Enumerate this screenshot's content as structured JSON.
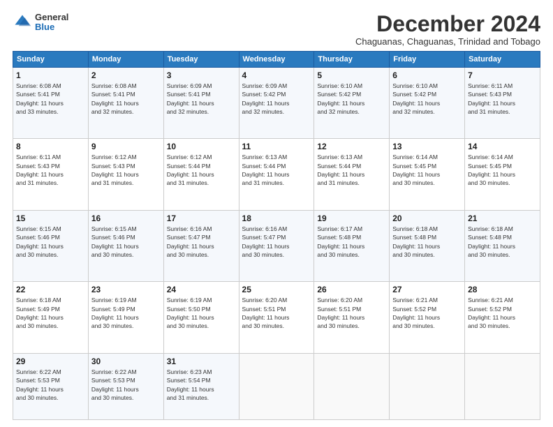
{
  "header": {
    "logo": {
      "general": "General",
      "blue": "Blue"
    },
    "title": "December 2024",
    "subtitle": "Chaguanas, Chaguanas, Trinidad and Tobago"
  },
  "calendar": {
    "days_of_week": [
      "Sunday",
      "Monday",
      "Tuesday",
      "Wednesday",
      "Thursday",
      "Friday",
      "Saturday"
    ],
    "weeks": [
      [
        {
          "day": "",
          "info": ""
        },
        {
          "day": "2",
          "info": "Sunrise: 6:08 AM\nSunset: 5:41 PM\nDaylight: 11 hours\nand 32 minutes."
        },
        {
          "day": "3",
          "info": "Sunrise: 6:09 AM\nSunset: 5:41 PM\nDaylight: 11 hours\nand 32 minutes."
        },
        {
          "day": "4",
          "info": "Sunrise: 6:09 AM\nSunset: 5:42 PM\nDaylight: 11 hours\nand 32 minutes."
        },
        {
          "day": "5",
          "info": "Sunrise: 6:10 AM\nSunset: 5:42 PM\nDaylight: 11 hours\nand 32 minutes."
        },
        {
          "day": "6",
          "info": "Sunrise: 6:10 AM\nSunset: 5:42 PM\nDaylight: 11 hours\nand 32 minutes."
        },
        {
          "day": "7",
          "info": "Sunrise: 6:11 AM\nSunset: 5:43 PM\nDaylight: 11 hours\nand 31 minutes."
        }
      ],
      [
        {
          "day": "1",
          "info": "Sunrise: 6:08 AM\nSunset: 5:41 PM\nDaylight: 11 hours\nand 33 minutes."
        },
        {
          "day": "9",
          "info": "Sunrise: 6:12 AM\nSunset: 5:43 PM\nDaylight: 11 hours\nand 31 minutes."
        },
        {
          "day": "10",
          "info": "Sunrise: 6:12 AM\nSunset: 5:44 PM\nDaylight: 11 hours\nand 31 minutes."
        },
        {
          "day": "11",
          "info": "Sunrise: 6:13 AM\nSunset: 5:44 PM\nDaylight: 11 hours\nand 31 minutes."
        },
        {
          "day": "12",
          "info": "Sunrise: 6:13 AM\nSunset: 5:44 PM\nDaylight: 11 hours\nand 31 minutes."
        },
        {
          "day": "13",
          "info": "Sunrise: 6:14 AM\nSunset: 5:45 PM\nDaylight: 11 hours\nand 30 minutes."
        },
        {
          "day": "14",
          "info": "Sunrise: 6:14 AM\nSunset: 5:45 PM\nDaylight: 11 hours\nand 30 minutes."
        }
      ],
      [
        {
          "day": "8",
          "info": "Sunrise: 6:11 AM\nSunset: 5:43 PM\nDaylight: 11 hours\nand 31 minutes."
        },
        {
          "day": "16",
          "info": "Sunrise: 6:15 AM\nSunset: 5:46 PM\nDaylight: 11 hours\nand 30 minutes."
        },
        {
          "day": "17",
          "info": "Sunrise: 6:16 AM\nSunset: 5:47 PM\nDaylight: 11 hours\nand 30 minutes."
        },
        {
          "day": "18",
          "info": "Sunrise: 6:16 AM\nSunset: 5:47 PM\nDaylight: 11 hours\nand 30 minutes."
        },
        {
          "day": "19",
          "info": "Sunrise: 6:17 AM\nSunset: 5:48 PM\nDaylight: 11 hours\nand 30 minutes."
        },
        {
          "day": "20",
          "info": "Sunrise: 6:18 AM\nSunset: 5:48 PM\nDaylight: 11 hours\nand 30 minutes."
        },
        {
          "day": "21",
          "info": "Sunrise: 6:18 AM\nSunset: 5:48 PM\nDaylight: 11 hours\nand 30 minutes."
        }
      ],
      [
        {
          "day": "15",
          "info": "Sunrise: 6:15 AM\nSunset: 5:46 PM\nDaylight: 11 hours\nand 30 minutes."
        },
        {
          "day": "23",
          "info": "Sunrise: 6:19 AM\nSunset: 5:49 PM\nDaylight: 11 hours\nand 30 minutes."
        },
        {
          "day": "24",
          "info": "Sunrise: 6:19 AM\nSunset: 5:50 PM\nDaylight: 11 hours\nand 30 minutes."
        },
        {
          "day": "25",
          "info": "Sunrise: 6:20 AM\nSunset: 5:51 PM\nDaylight: 11 hours\nand 30 minutes."
        },
        {
          "day": "26",
          "info": "Sunrise: 6:20 AM\nSunset: 5:51 PM\nDaylight: 11 hours\nand 30 minutes."
        },
        {
          "day": "27",
          "info": "Sunrise: 6:21 AM\nSunset: 5:52 PM\nDaylight: 11 hours\nand 30 minutes."
        },
        {
          "day": "28",
          "info": "Sunrise: 6:21 AM\nSunset: 5:52 PM\nDaylight: 11 hours\nand 30 minutes."
        }
      ],
      [
        {
          "day": "22",
          "info": "Sunrise: 6:18 AM\nSunset: 5:49 PM\nDaylight: 11 hours\nand 30 minutes."
        },
        {
          "day": "30",
          "info": "Sunrise: 6:22 AM\nSunset: 5:53 PM\nDaylight: 11 hours\nand 30 minutes."
        },
        {
          "day": "31",
          "info": "Sunrise: 6:23 AM\nSunset: 5:54 PM\nDaylight: 11 hours\nand 31 minutes."
        },
        {
          "day": "",
          "info": ""
        },
        {
          "day": "",
          "info": ""
        },
        {
          "day": "",
          "info": ""
        },
        {
          "day": "",
          "info": ""
        }
      ],
      [
        {
          "day": "29",
          "info": "Sunrise: 6:22 AM\nSunset: 5:53 PM\nDaylight: 11 hours\nand 30 minutes."
        },
        {
          "day": "",
          "info": ""
        },
        {
          "day": "",
          "info": ""
        },
        {
          "day": "",
          "info": ""
        },
        {
          "day": "",
          "info": ""
        },
        {
          "day": "",
          "info": ""
        },
        {
          "day": "",
          "info": ""
        }
      ]
    ]
  }
}
